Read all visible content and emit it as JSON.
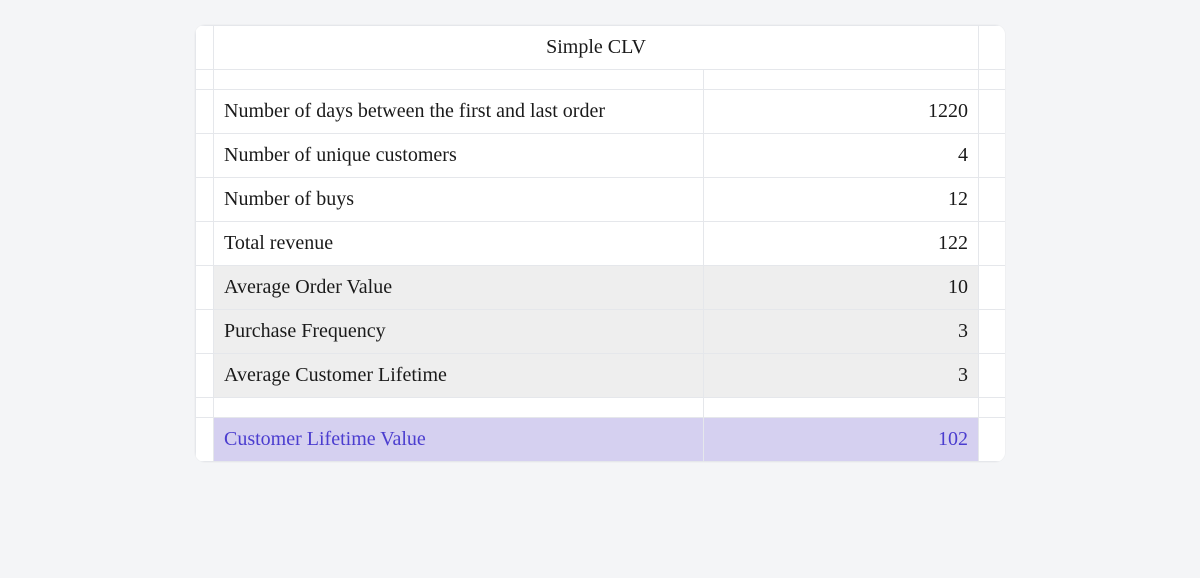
{
  "title": "Simple CLV",
  "rows": [
    {
      "label": "Number of days between the first and last order",
      "value": "1220",
      "style": "plain"
    },
    {
      "label": "Number of unique customers",
      "value": "4",
      "style": "plain"
    },
    {
      "label": "Number of buys",
      "value": "12",
      "style": "plain"
    },
    {
      "label": "Total revenue",
      "value": "122",
      "style": "plain"
    },
    {
      "label": "Average Order Value",
      "value": "10",
      "style": "shaded"
    },
    {
      "label": "Purchase Frequency",
      "value": "3",
      "style": "shaded"
    },
    {
      "label": "Average Customer Lifetime",
      "value": "3",
      "style": "shaded"
    }
  ],
  "result": {
    "label": "Customer Lifetime Value",
    "value": "102"
  }
}
